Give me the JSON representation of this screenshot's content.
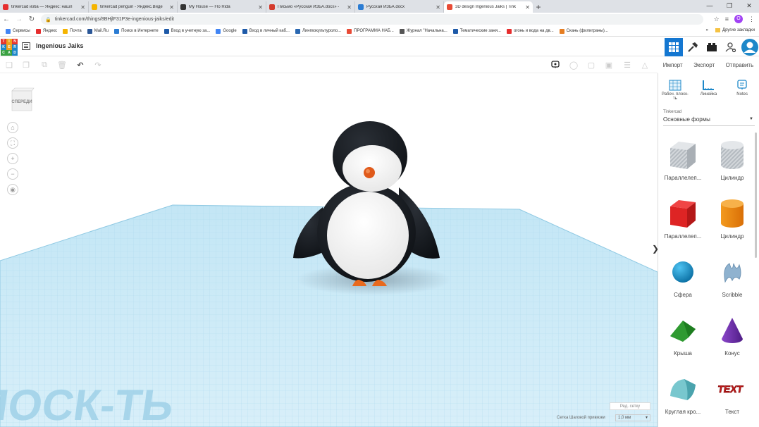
{
  "browser": {
    "tabs": [
      {
        "title": "tinkercad изба — Яндекс: нашл",
        "color": "#e62e2e"
      },
      {
        "title": "tinkercad penguin - Яндекс.Виде",
        "color": "#f5b400"
      },
      {
        "title": "My House — Flo Rida",
        "color": "#333"
      },
      {
        "title": "Письмо «Русская ИЗБА.docx» -",
        "color": "#d43b2d"
      },
      {
        "title": "Русская ИЗБА.docx",
        "color": "#2b7cd3"
      },
      {
        "title": "3D design Ingenious Jaiks | Tink",
        "color": "#e84b36"
      }
    ],
    "url": "tinkercad.com/things/8BHjlF31P3e-ingenious-jaiks/edit",
    "bookmarks": [
      "Сервисы",
      "Яндекс",
      "Почта",
      "Mail.Ru",
      "Поиск в Интернете",
      "Вход в учетную за...",
      "Google",
      "Вход в личный каб...",
      "Лингвокультуроло...",
      "ПРОГРАММА НАБ...",
      "Журнал \"Начальна...",
      "Тематические заня...",
      "огонь и вода на дв...",
      "Скань (филиграны)..."
    ],
    "bookmark_colors": [
      "#4285f4",
      "#e62e2e",
      "#f5b400",
      "#2b5797",
      "#2b7cd3",
      "#1e5aa8",
      "#4285f4",
      "#1e5aa8",
      "#2a68b1",
      "#e84b36",
      "#555",
      "#1e5aa8",
      "#e62e2e",
      "#e67e22"
    ],
    "other_bookmarks": "Другие закладки",
    "profile_initial": "О"
  },
  "app": {
    "logo_letters": [
      "T",
      "I",
      "N",
      "K",
      "E",
      "R",
      "C",
      "A",
      "D"
    ],
    "logo_colors": [
      "#e8382e",
      "#f0a21b",
      "#e8382e",
      "#1e88c9",
      "#f0a21b",
      "#1e88c9",
      "#3aa142",
      "#3aa142",
      "#1e88c9"
    ],
    "title": "Ingenious Jaiks"
  },
  "toolbar": {
    "import": "Импорт",
    "export": "Экспорт",
    "send": "Отправить"
  },
  "panel": {
    "tools": [
      {
        "label": "Рабоч. плоск-ть",
        "icon": "workplane-icon"
      },
      {
        "label": "Линейка",
        "icon": "ruler-icon"
      },
      {
        "label": "Notes",
        "icon": "notes-icon"
      }
    ],
    "library_label": "Tinkercad",
    "library_value": "Основные формы",
    "shapes": [
      {
        "label": "Параллелеп...",
        "kind": "box-hole"
      },
      {
        "label": "Цилиндр",
        "kind": "cyl-hole"
      },
      {
        "label": "Параллелеп...",
        "kind": "box"
      },
      {
        "label": "Цилиндр",
        "kind": "cyl"
      },
      {
        "label": "Сфера",
        "kind": "sphere"
      },
      {
        "label": "Scribble",
        "kind": "scribble"
      },
      {
        "label": "Крыша",
        "kind": "roof"
      },
      {
        "label": "Конус",
        "kind": "cone"
      },
      {
        "label": "Круглая кро...",
        "kind": "roundroof"
      },
      {
        "label": "Текст",
        "kind": "text"
      }
    ]
  },
  "viewport": {
    "viewcube_label": "СПЕРЕДИ",
    "workplane_label": "ПЛОСК-ТЬ",
    "edit_grid": "Ред. сетку",
    "snap_label": "Сетка Шаговой привязки",
    "snap_value": "1,0 мм"
  }
}
